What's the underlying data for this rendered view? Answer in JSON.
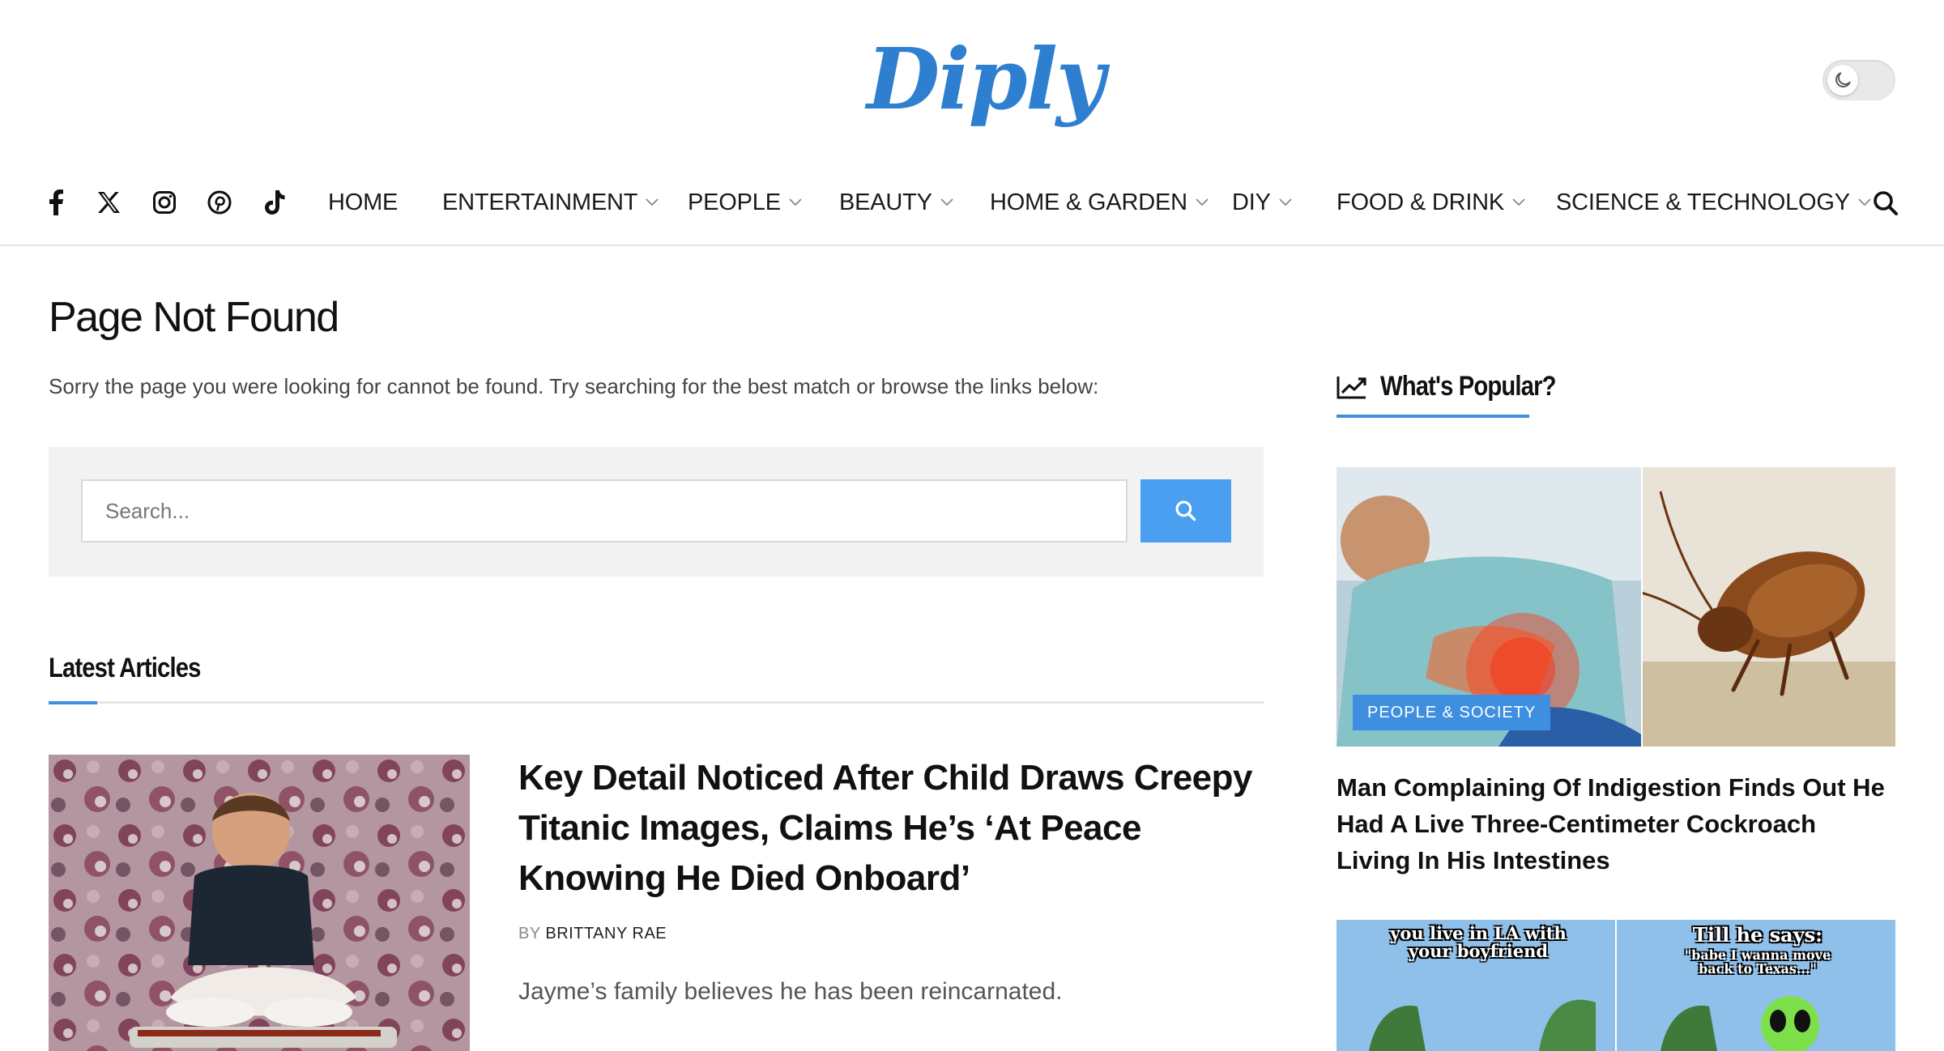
{
  "header": {
    "logo": "Diply",
    "dark_mode_icon": "moon-icon"
  },
  "nav": {
    "social": [
      "facebook-icon",
      "x-icon",
      "instagram-icon",
      "pinterest-icon",
      "tiktok-icon"
    ],
    "items": [
      {
        "label": "HOME"
      },
      {
        "label": "ENTERTAINMENT"
      },
      {
        "label": "PEOPLE"
      },
      {
        "label": "BEAUTY"
      },
      {
        "label": "HOME & GARDEN"
      },
      {
        "label": "DIY"
      },
      {
        "label": "FOOD & DRINK"
      },
      {
        "label": "SCIENCE & TECHNOLOGY"
      }
    ],
    "search_icon": "search-icon"
  },
  "main": {
    "title": "Page Not Found",
    "text": "Sorry the page you were looking for cannot be found. Try searching for the best match or browse the links below:",
    "search": {
      "placeholder": "Search..."
    },
    "latest_title": "Latest Articles",
    "article": {
      "title": "Key Detail Noticed After Child Draws Creepy Titanic Images, Claims He’s ‘At Peace Knowing He Died Onboard’",
      "by": "BY",
      "author": "BRITTANY RAE",
      "excerpt": "Jayme’s family believes he has been reincarnated."
    }
  },
  "sidebar": {
    "popular_title": "What's Popular?",
    "card1": {
      "badge": "PEOPLE & SOCIETY",
      "title": "Man Complaining Of Indigestion Finds Out He Had A Live Three-Centimeter Cockroach Living In His Intestines"
    },
    "card2": {
      "meme_left": "you live in LA with your boyfriend",
      "meme_right_top": "Till he says:",
      "meme_right_sub": "\"babe I wanna move back to Texas...\""
    }
  },
  "colors": {
    "brand": "#2f7fd1",
    "accent": "#3f8fe0",
    "search_button": "#4a9ff0"
  }
}
